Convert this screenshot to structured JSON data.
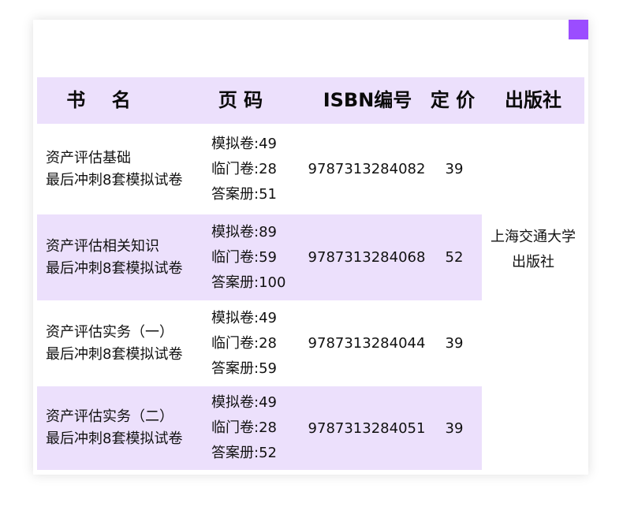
{
  "table": {
    "headers": {
      "name": "书    名",
      "pages": "页 码",
      "isbn": "ISBN编号",
      "price": "定 价",
      "publisher": "出版社"
    },
    "rows": [
      {
        "title_line1": "资产评估基础",
        "title_line2": "最后冲刺8套模拟试卷",
        "pages": [
          "模拟卷:49",
          "临门卷:28",
          "答案册:51"
        ],
        "isbn": "9787313284082",
        "price": "39"
      },
      {
        "title_line1": "资产评估相关知识",
        "title_line2": "最后冲刺8套模拟试卷",
        "pages": [
          "模拟卷:89",
          "临门卷:59",
          "答案册:100"
        ],
        "isbn": "9787313284068",
        "price": "52"
      },
      {
        "title_line1": "资产评估实务（一）",
        "title_line2": "最后冲刺8套模拟试卷",
        "pages": [
          "模拟卷:49",
          "临门卷:28",
          "答案册:59"
        ],
        "isbn": "9787313284044",
        "price": "39"
      },
      {
        "title_line1": "资产评估实务（二）",
        "title_line2": "最后冲刺8套模拟试卷",
        "pages": [
          "模拟卷:49",
          "临门卷:28",
          "答案册:52"
        ],
        "isbn": "9787313284051",
        "price": "39"
      }
    ],
    "publisher_line1": "上海交通大学",
    "publisher_line2": "出版社"
  },
  "colors": {
    "header_bg": "#ece0fc",
    "shaded_row_bg": "#ece0fc",
    "accent_square": "#9b4dff"
  }
}
